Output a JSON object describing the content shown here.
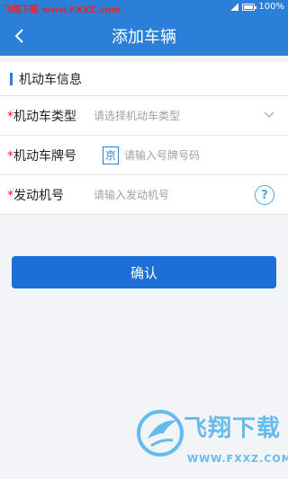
{
  "status_bar": {
    "watermark": "飞翔下载 www.FXXZ.com",
    "battery": "100%"
  },
  "header": {
    "title": "添加车辆"
  },
  "section": {
    "title": "机动车信息"
  },
  "form": {
    "vehicle_type": {
      "required": "*",
      "label": "机动车类型",
      "placeholder": "请选择机动车类型"
    },
    "plate_number": {
      "required": "*",
      "label": "机动车牌号",
      "province": "京",
      "placeholder": "请输入号牌号码"
    },
    "engine_number": {
      "required": "*",
      "label": "发动机号",
      "placeholder": "请输入发动机号",
      "help": "?"
    }
  },
  "confirm": {
    "label": "确认"
  },
  "watermark_logo": {
    "text": "飞翔下载",
    "url": "WWW.FXXZ.COM"
  },
  "colors": {
    "primary": "#2a7fd8",
    "button": "#1b6fd6",
    "required": "#e02020"
  }
}
